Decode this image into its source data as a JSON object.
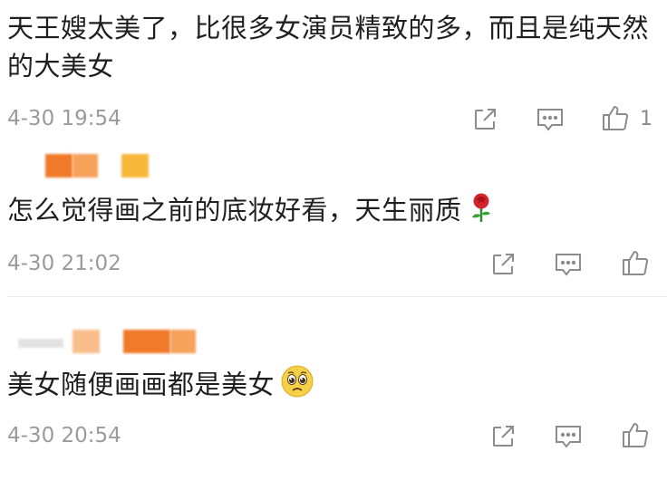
{
  "comments": [
    {
      "text": "天王嫂太美了，比很多女演员精致的多，而且是纯天然的大美女",
      "time": "4-30 19:54",
      "like_count": "1"
    },
    {
      "text": "怎么觉得画之前的底妆好看，天生丽质",
      "emoji": "rose-emoji",
      "time": "4-30 21:02"
    },
    {
      "text": "美女随便画画都是美女",
      "emoji": "pleading-face-emoji",
      "time": "4-30 20:54"
    }
  ],
  "colors": {
    "text": "#1f1f1f",
    "meta": "#9b9b9b",
    "icon": "#8c8c8c",
    "username_blur_orange": "#f07a2a",
    "username_blur_light_orange": "#f6a25b",
    "username_blur_yellow": "#f7b83a"
  }
}
